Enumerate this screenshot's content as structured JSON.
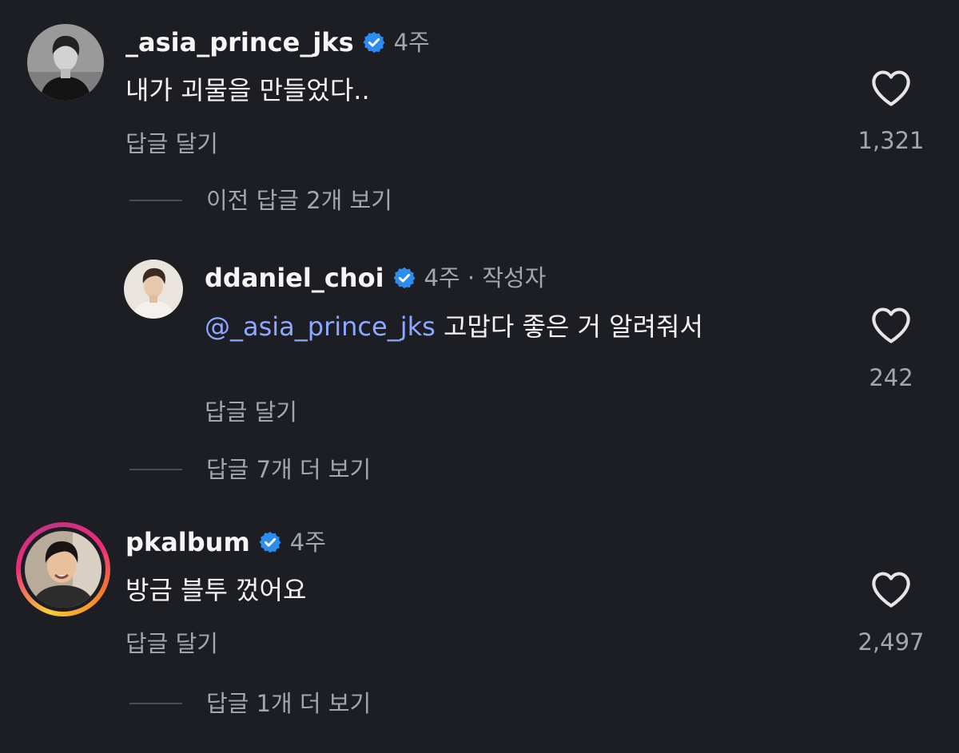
{
  "colors": {
    "background": "#1c1e23",
    "verified": "#2d8cf0",
    "mention": "#8ea7ff",
    "secondary_text": "#a3a6ad"
  },
  "comments": [
    {
      "username": "_asia_prince_jks",
      "verified": true,
      "time": "4주",
      "text": "내가 괴물을 만들었다..",
      "reply_label": "답글 달기",
      "likes": "1,321",
      "view_replies": "이전 답글 2개 보기"
    },
    {
      "username": "ddaniel_choi",
      "verified": true,
      "time": "4주",
      "author_tag": " · 작성자",
      "mention": "@_asia_prince_jks",
      "text": " 고맙다 좋은 거 알려줘서",
      "reply_label": "답글 달기",
      "likes": "242",
      "view_replies": "답글 7개 더 보기"
    },
    {
      "username": "pkalbum",
      "verified": true,
      "time": "4주",
      "text": "방금 블투 껐어요",
      "reply_label": "답글 달기",
      "likes": "2,497",
      "view_replies": "답글 1개 더 보기",
      "has_story_ring": true
    }
  ],
  "icons": {
    "verified": "verified-badge-icon",
    "like": "heart-outline-icon"
  }
}
